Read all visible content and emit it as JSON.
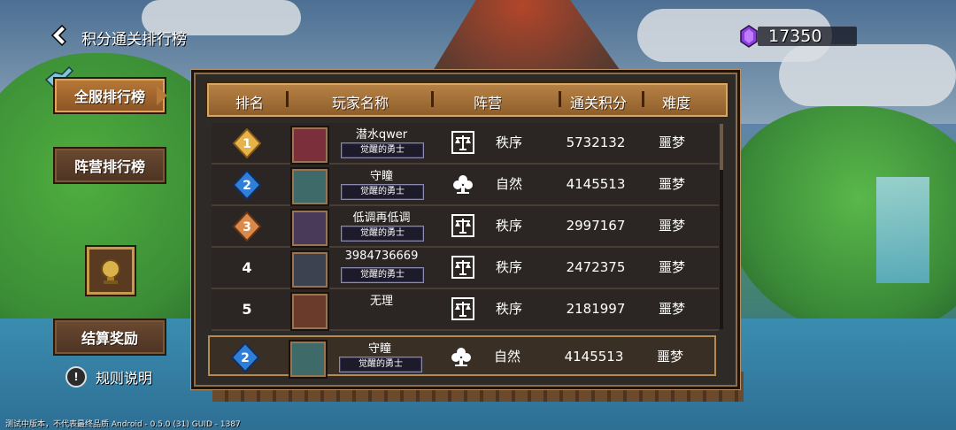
{
  "header": {
    "title": "积分通关排行榜",
    "currency_value": "17350"
  },
  "nav": {
    "global_label": "全服排行榜",
    "faction_label": "阵营排行榜",
    "settle_label": "结算奖励",
    "rules_label": "规则说明"
  },
  "table": {
    "columns": {
      "rank": "排名",
      "player": "玩家名称",
      "faction": "阵营",
      "score": "通关积分",
      "difficulty": "难度"
    },
    "rows": [
      {
        "rank": "1",
        "medal": "gold",
        "name": "潜水qwer",
        "badge": "觉醒的勇士",
        "faction": "秩序",
        "faction_icon": "scales",
        "score": "5732132",
        "difficulty": "噩梦"
      },
      {
        "rank": "2",
        "medal": "blue",
        "name": "守瞳",
        "badge": "觉醒的勇士",
        "faction": "自然",
        "faction_icon": "nature",
        "score": "4145513",
        "difficulty": "噩梦"
      },
      {
        "rank": "3",
        "medal": "bronze",
        "name": "低调再低调",
        "badge": "觉醒的勇士",
        "faction": "秩序",
        "faction_icon": "scales",
        "score": "2997167",
        "difficulty": "噩梦"
      },
      {
        "rank": "4",
        "medal": "",
        "name": "3984736669",
        "badge": "觉醒的勇士",
        "faction": "秩序",
        "faction_icon": "scales",
        "score": "2472375",
        "difficulty": "噩梦"
      },
      {
        "rank": "5",
        "medal": "",
        "name": "无理",
        "badge": "",
        "faction": "秩序",
        "faction_icon": "scales",
        "score": "2181997",
        "difficulty": "噩梦"
      }
    ],
    "self_row": {
      "rank": "2",
      "medal": "blue",
      "name": "守瞳",
      "badge": "觉醒的勇士",
      "faction": "自然",
      "faction_icon": "nature",
      "score": "4145513",
      "difficulty": "噩梦"
    }
  },
  "footer": {
    "version_text": "测试中版本，不代表最终品质    Android - 0.5.0 (31)    GUID - 1387"
  },
  "colors": {
    "accent": "#b97a38",
    "panel": "#2e2a28",
    "gem": "#8b3fd8"
  },
  "icons": [
    "back-icon",
    "gem-icon",
    "bird-icon",
    "trophy-icon",
    "info-icon",
    "scales-icon",
    "nature-icon",
    "medal-gold-icon",
    "medal-blue-icon",
    "medal-bronze-icon"
  ]
}
